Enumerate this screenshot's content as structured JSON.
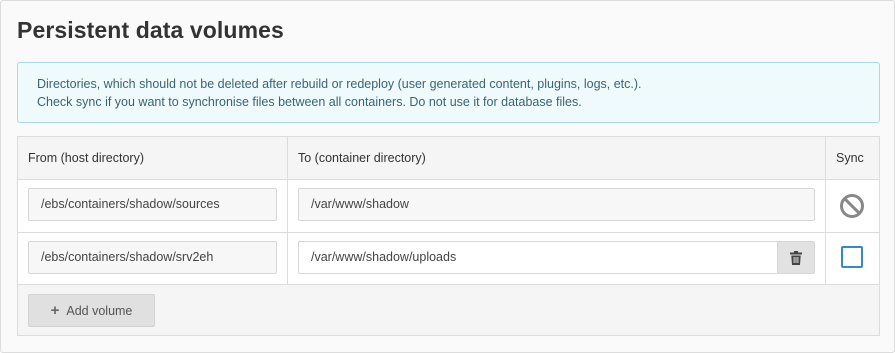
{
  "panel": {
    "title": "Persistent data volumes",
    "info_lines": [
      "Directories, which should not be deleted after rebuild or redeploy (user generated content, plugins, logs, etc.).",
      "Check sync if you want to synchronise files between all containers. Do not use it for database files."
    ]
  },
  "table": {
    "headers": {
      "from": "From (host directory)",
      "to": "To (container directory)",
      "sync": "Sync"
    },
    "rows": [
      {
        "from": "/ebs/containers/shadow/sources",
        "to": "/var/www/shadow",
        "sync_state": "disabled",
        "sync_icon": "ban-icon",
        "deletable": false
      },
      {
        "from": "/ebs/containers/shadow/srv2eh",
        "to": "/var/www/shadow/uploads",
        "sync_state": "unchecked",
        "sync_icon": "checkbox",
        "deletable": true,
        "delete_icon": "trash-icon"
      }
    ],
    "add_button": {
      "icon": "plus-icon",
      "label": "Add volume"
    }
  },
  "colors": {
    "info_bg": "#effafd",
    "info_border": "#a9dbe6",
    "checkbox_accent": "#3a87c7",
    "ban_icon": "#888888"
  }
}
